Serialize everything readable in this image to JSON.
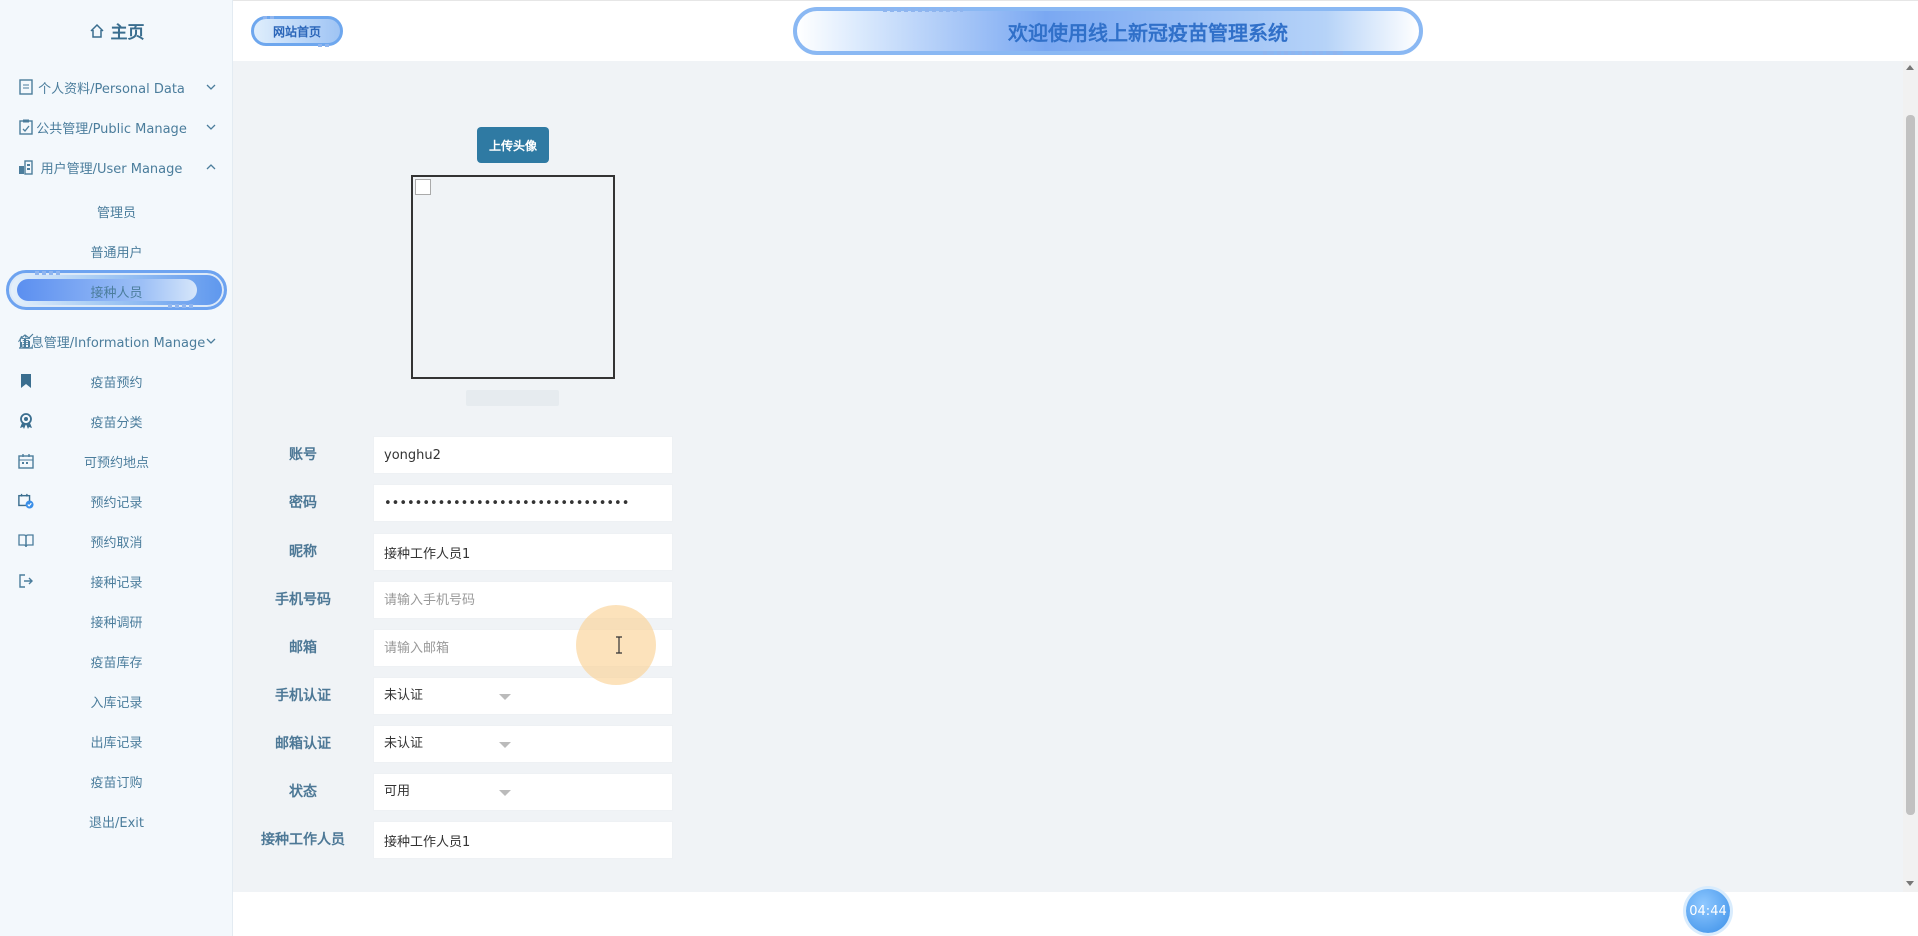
{
  "sidebar": {
    "home_label": "主页",
    "items": [
      {
        "label": "个人资料/Personal Data"
      },
      {
        "label": "公共管理/Public Manage"
      },
      {
        "label": "用户管理/User Manage"
      },
      {
        "label": "管理员"
      },
      {
        "label": "普通用户"
      },
      {
        "label": "接种人员"
      },
      {
        "label": "信息管理/Information Manage"
      },
      {
        "label": "疫苗预约"
      },
      {
        "label": "疫苗分类"
      },
      {
        "label": "可预约地点"
      },
      {
        "label": "预约记录"
      },
      {
        "label": "预约取消"
      },
      {
        "label": "接种记录"
      },
      {
        "label": "接种调研"
      },
      {
        "label": "疫苗库存"
      },
      {
        "label": "入库记录"
      },
      {
        "label": "出库记录"
      },
      {
        "label": "疫苗订购"
      },
      {
        "label": "退出/Exit"
      }
    ]
  },
  "header": {
    "site_home": "网站首页",
    "title": "欢迎使用线上新冠疫苗管理系统"
  },
  "form": {
    "upload_label": "上传头像",
    "fields": [
      {
        "label": "账号",
        "value": "yonghu2",
        "placeholder": ""
      },
      {
        "label": "密码",
        "value": "********************************",
        "placeholder": ""
      },
      {
        "label": "昵称",
        "value": "接种工作人员1",
        "placeholder": ""
      },
      {
        "label": "手机号码",
        "value": "",
        "placeholder": "请输入手机号码"
      },
      {
        "label": "邮箱",
        "value": "",
        "placeholder": "请输入邮箱"
      },
      {
        "label": "手机认证",
        "value": "未认证"
      },
      {
        "label": "邮箱认证",
        "value": "未认证"
      },
      {
        "label": "状态",
        "value": "可用"
      },
      {
        "label": "接种工作人员",
        "value": "接种工作人员1",
        "placeholder": ""
      }
    ]
  },
  "clock": "04:44",
  "colors": {
    "accent": "#2f7aa3",
    "sidebar_text": "#4b7d9c",
    "banner_text": "#3070c9"
  }
}
